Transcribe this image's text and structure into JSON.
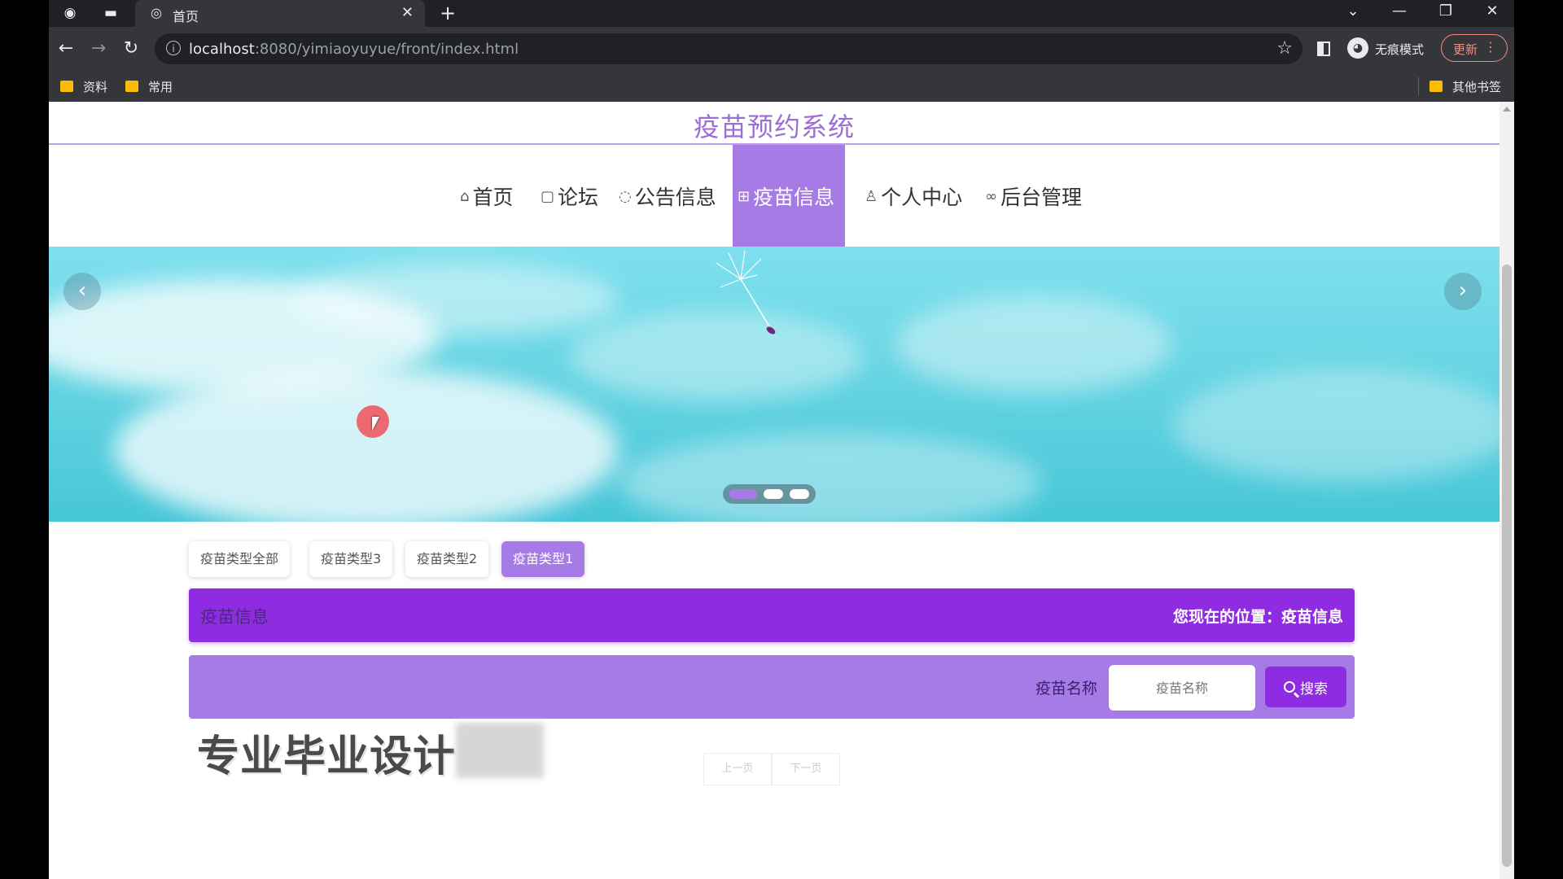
{
  "browser": {
    "tab_title": "首页",
    "url_host": "localhost",
    "url_rest": ":8080/yimiaoyuyue/front/index.html",
    "incognito_label": "无痕模式",
    "update_label": "更新",
    "bookmarks": [
      {
        "label": "资料"
      },
      {
        "label": "常用"
      }
    ],
    "other_bookmarks": "其他书签"
  },
  "site": {
    "title": "疫苗预约系统"
  },
  "nav": {
    "items": [
      {
        "icon": "home-icon",
        "label": "首页"
      },
      {
        "icon": "forum-icon",
        "label": "论坛"
      },
      {
        "icon": "notice-icon",
        "label": "公告信息"
      },
      {
        "icon": "vaccine-icon",
        "label": "疫苗信息",
        "active": true
      },
      {
        "icon": "user-icon",
        "label": "个人中心"
      },
      {
        "icon": "link-icon",
        "label": "后台管理"
      }
    ]
  },
  "banner": {
    "slide_count": 3,
    "active_slide": 1
  },
  "categories": [
    {
      "label": "疫苗类型全部"
    },
    {
      "label": "疫苗类型3"
    },
    {
      "label": "疫苗类型2"
    },
    {
      "label": "疫苗类型1",
      "active": true
    }
  ],
  "section": {
    "title": "疫苗信息",
    "breadcrumb": "您现在的位置：疫苗信息"
  },
  "search": {
    "label": "疫苗名称",
    "placeholder": "疫苗名称",
    "button": "搜索"
  },
  "watermark": "专业毕业设计",
  "pager": {
    "prev": "上一页",
    "next": "下一页"
  },
  "colors": {
    "accent": "#a77be6",
    "accent_dark": "#8f2be0",
    "title": "#9b6fd1"
  }
}
